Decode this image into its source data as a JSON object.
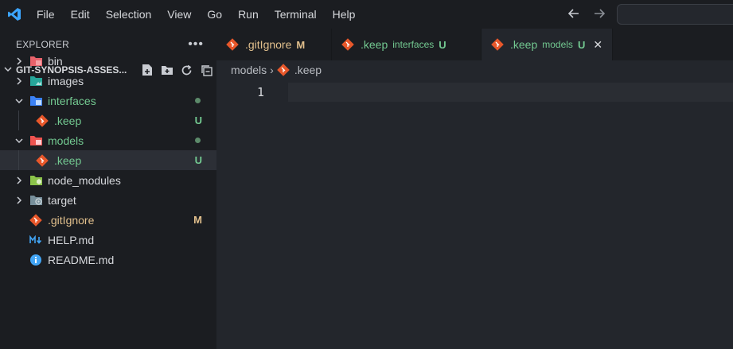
{
  "menu": [
    "File",
    "Edit",
    "Selection",
    "View",
    "Go",
    "Run",
    "Terminal",
    "Help"
  ],
  "icons": {
    "app": "vscode-logo-icon",
    "back": "arrow-left-icon",
    "forward": "arrow-right-icon"
  },
  "colors": {
    "accent": "#3ca5ff",
    "untracked": "#73c991",
    "modified": "#e2c08d",
    "git": "#e8572a"
  },
  "sidebar": {
    "title": "EXPLORER",
    "more": "•••",
    "folder": "GIT-SYNOPSIS-ASSES...",
    "tree": [
      {
        "label": "bin",
        "type": "folder",
        "expanded": false,
        "icon": "folder-bin-icon"
      },
      {
        "label": "images",
        "type": "folder",
        "expanded": false,
        "icon": "folder-images-icon"
      },
      {
        "label": "interfaces",
        "type": "folder",
        "expanded": true,
        "icon": "folder-interfaces-icon",
        "dot": true
      },
      {
        "label": ".keep",
        "type": "file",
        "child": true,
        "icon": "git-file-icon",
        "status": "U"
      },
      {
        "label": "models",
        "type": "folder",
        "expanded": true,
        "icon": "folder-models-icon",
        "dot": true
      },
      {
        "label": ".keep",
        "type": "file",
        "child": true,
        "icon": "git-file-icon",
        "status": "U",
        "selected": true
      },
      {
        "label": "node_modules",
        "type": "folder",
        "expanded": false,
        "icon": "folder-node-icon"
      },
      {
        "label": "target",
        "type": "folder",
        "expanded": false,
        "icon": "folder-target-icon"
      },
      {
        "label": ".gitIgnore",
        "type": "file",
        "icon": "git-file-icon",
        "status": "M"
      },
      {
        "label": "HELP.md",
        "type": "file",
        "icon": "markdown-icon"
      },
      {
        "label": "README.md",
        "type": "file",
        "icon": "info-icon"
      }
    ]
  },
  "tabs": [
    {
      "name": ".gitIgnore",
      "desc": "",
      "status": "M",
      "active": false
    },
    {
      "name": ".keep",
      "desc": "interfaces",
      "status": "U",
      "active": false
    },
    {
      "name": ".keep",
      "desc": "models",
      "status": "U",
      "active": true,
      "close": "✕"
    }
  ],
  "breadcrumb": {
    "folder": "models",
    "sep": "›",
    "file": ".keep"
  },
  "editor": {
    "line_number": "1"
  }
}
